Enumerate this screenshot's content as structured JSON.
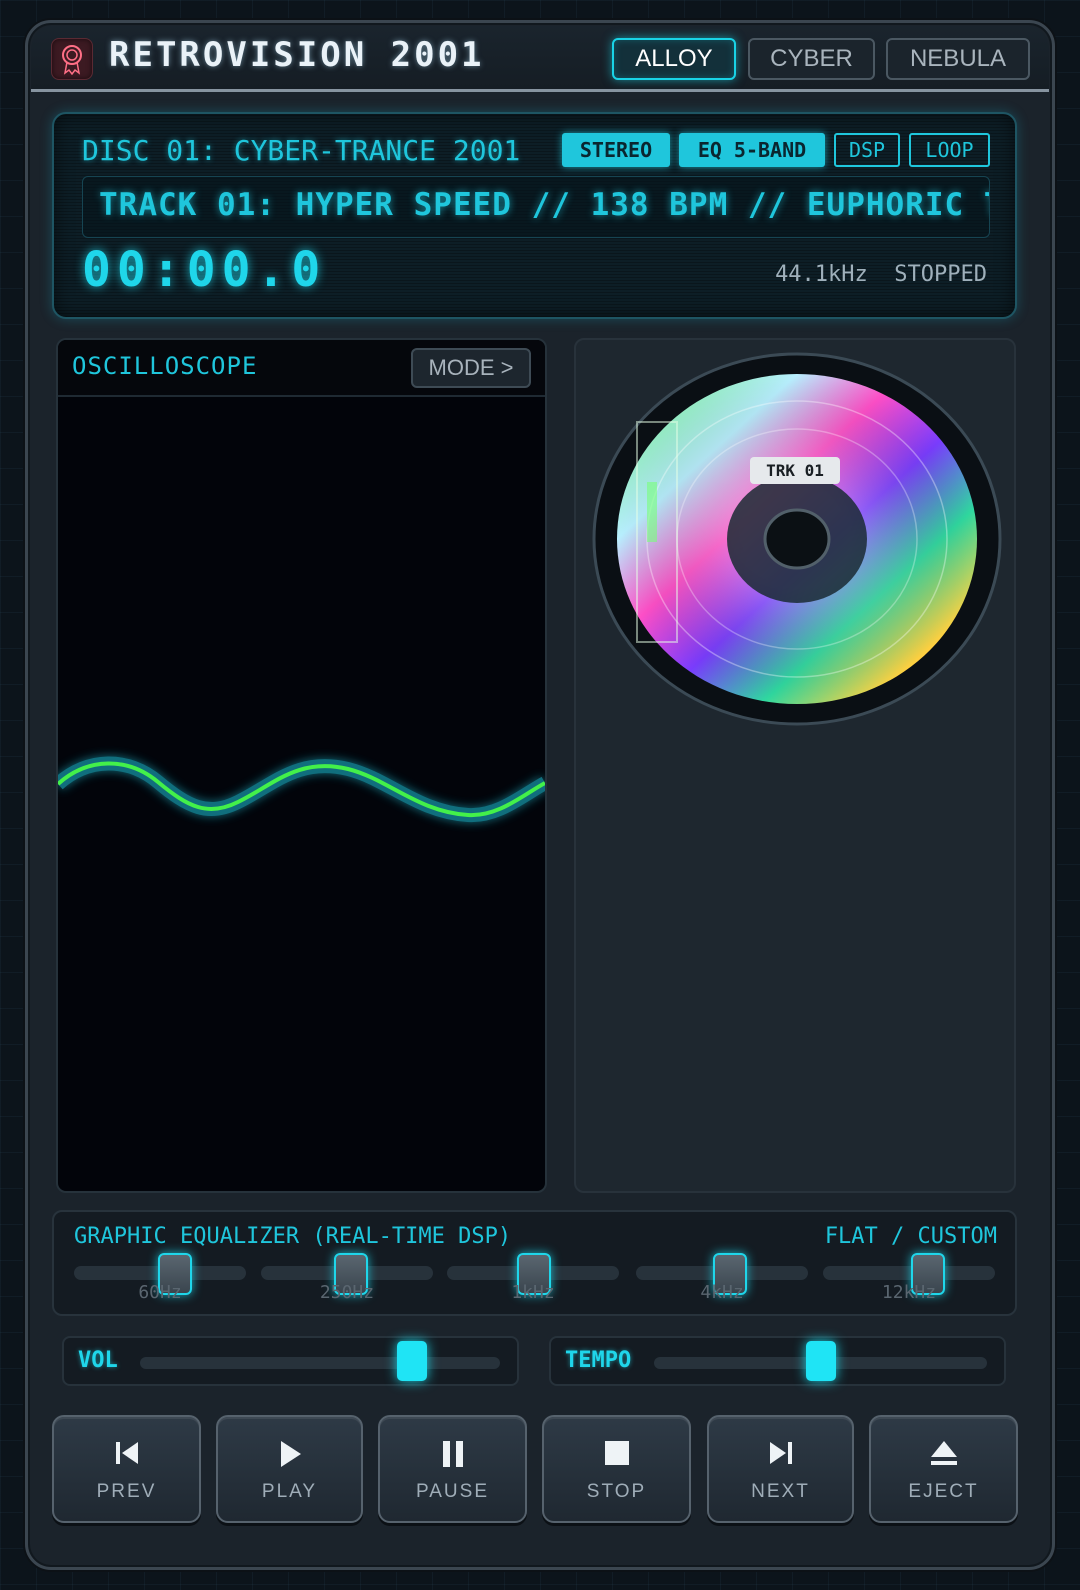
{
  "app": {
    "title": "RETROVISION 2001"
  },
  "skins": [
    {
      "label": "ALLOY",
      "active": true
    },
    {
      "label": "CYBER",
      "active": false
    },
    {
      "label": "NEBULA",
      "active": false
    }
  ],
  "display": {
    "disc_title": "DISC 01: CYBER-TRANCE 2001",
    "badges": [
      {
        "label": "STEREO",
        "on": true
      },
      {
        "label": "EQ 5-BAND",
        "on": true
      },
      {
        "label": "DSP",
        "on": false
      },
      {
        "label": "LOOP",
        "on": false
      }
    ],
    "marquee": "TRACK 01: HYPER SPEED // 138 BPM // EUPHORIC T",
    "timecode": "00:00.0",
    "sample_rate": "44.1kHz",
    "state": "STOPPED"
  },
  "scope": {
    "title": "OSCILLOSCOPE",
    "mode_label": "MODE >"
  },
  "disc": {
    "label": "TRK 01"
  },
  "equalizer": {
    "title": "GRAPHIC EQUALIZER (REAL-TIME DSP)",
    "preset": "FLAT / CUSTOM",
    "bands": [
      {
        "label": "60Hz",
        "level": 0.61
      },
      {
        "label": "250Hz",
        "level": 0.53
      },
      {
        "label": "1kHz",
        "level": 0.51
      },
      {
        "label": "4kHz",
        "level": 0.56
      },
      {
        "label": "12kHz",
        "level": 0.64
      }
    ]
  },
  "volume": {
    "label": "VOL",
    "level": 0.78
  },
  "tempo": {
    "label": "TEMPO",
    "level": 0.5
  },
  "controls": [
    {
      "label": "PREV",
      "icon": "skip-back-icon"
    },
    {
      "label": "PLAY",
      "icon": "play-icon"
    },
    {
      "label": "PAUSE",
      "icon": "pause-icon"
    },
    {
      "label": "STOP",
      "icon": "stop-icon"
    },
    {
      "label": "NEXT",
      "icon": "skip-forward-icon"
    },
    {
      "label": "EJECT",
      "icon": "eject-icon"
    }
  ],
  "colors": {
    "accent": "#1fd6ea",
    "wave_core": "#43f04a",
    "wave_glow": "#1fc6dc"
  }
}
